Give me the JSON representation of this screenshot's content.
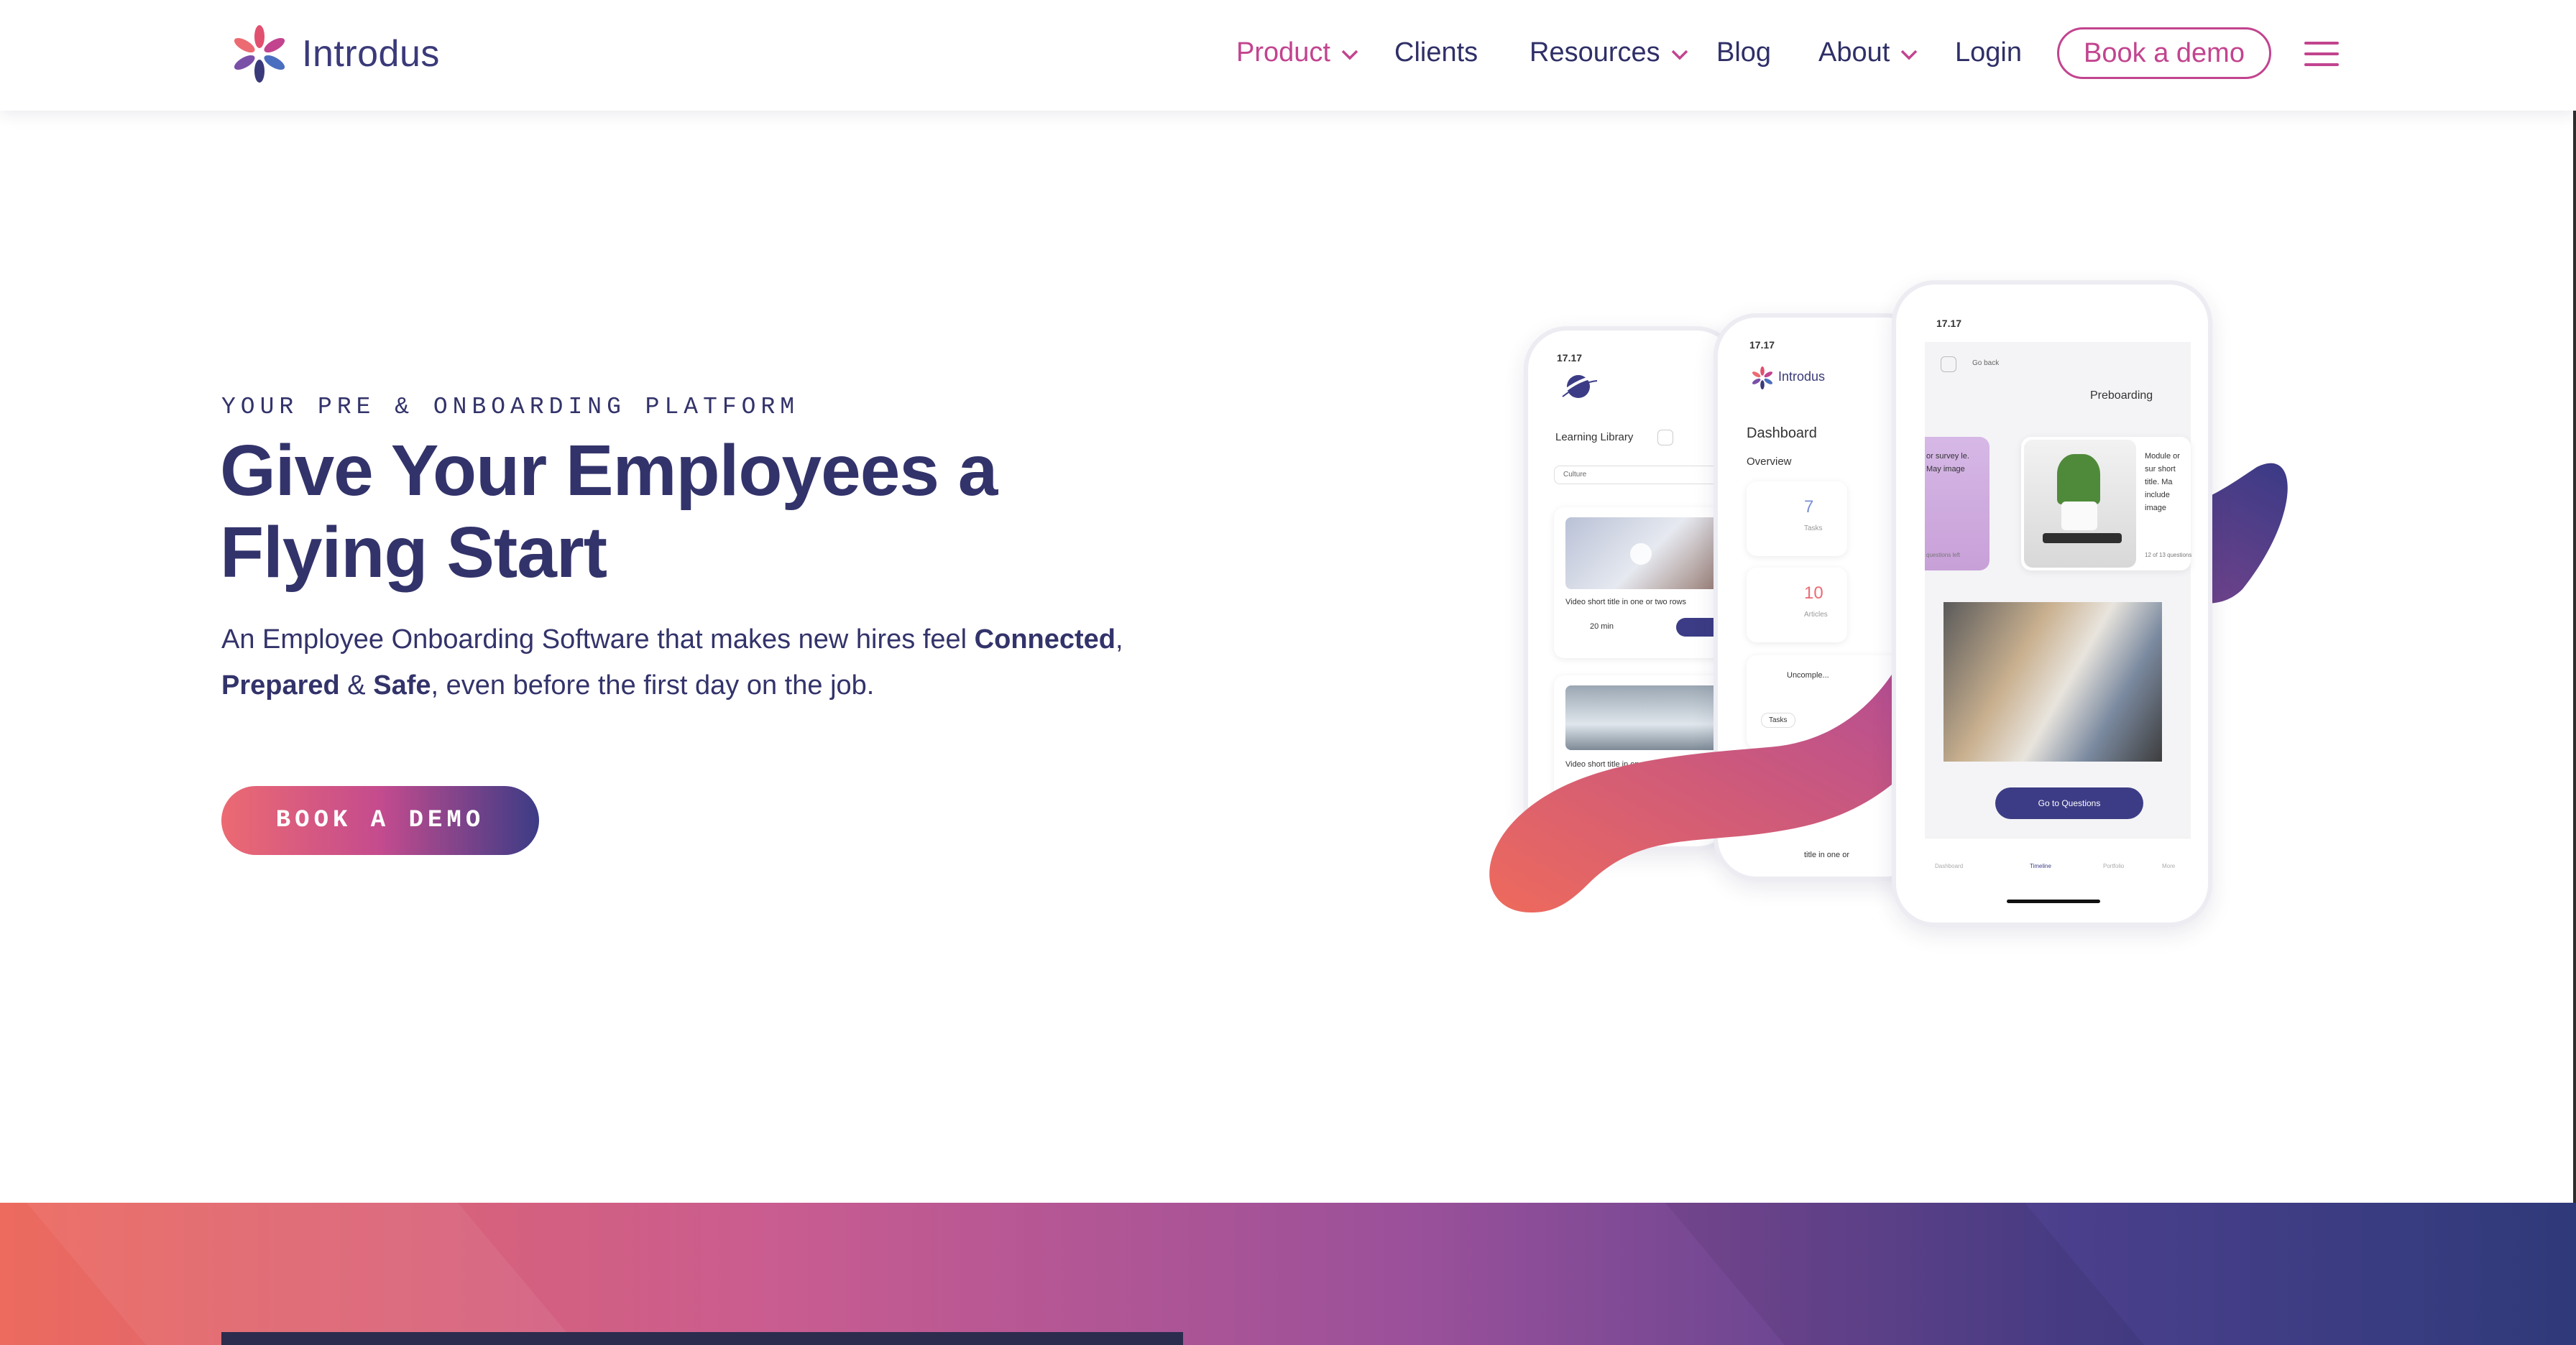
{
  "brand": {
    "name": "Introdus"
  },
  "nav": {
    "items": [
      {
        "label": "Product",
        "dropdown": true,
        "active": true
      },
      {
        "label": "Clients",
        "dropdown": false
      },
      {
        "label": "Resources",
        "dropdown": true
      },
      {
        "label": "Blog",
        "dropdown": false
      },
      {
        "label": "About",
        "dropdown": true
      },
      {
        "label": "Login",
        "dropdown": false
      }
    ],
    "cta_label": "Book a demo"
  },
  "hero": {
    "eyebrow": "YOUR PRE & ONBOARDING PLATFORM",
    "title_line1": "Give Your Employees a",
    "title_line2": "Flying Start",
    "sub_part1": "An Employee Onboarding Software that makes new hires feel ",
    "sub_b1": "Connected",
    "sub_part2": ",",
    "sub_b2": "Prepared",
    "sub_part3": " & ",
    "sub_b3": "Safe",
    "sub_part4": ", even before the first day on the job.",
    "cta_label": "BOOK A DEMO"
  },
  "phones": {
    "left": {
      "time": "17.17",
      "section": "Learning Library",
      "filter": "Culture",
      "video1_caption": "Video short title in one or two rows",
      "video1_duration": "20 min",
      "video2_caption": "Video short title in one or two rows"
    },
    "middle": {
      "time": "17.17",
      "brand": "Introdus",
      "heading": "Dashboard",
      "overview": "Overview",
      "tasks_count": "7",
      "tasks_label": "Tasks",
      "articles_count": "10",
      "articles_label": "Articles",
      "uncompleted": "Uncomple...",
      "tasks_chip": "Tasks",
      "footer_text": "title in one or"
    },
    "right": {
      "time": "17.17",
      "back": "Go back",
      "heading": "Preboarding",
      "card1_text": "or survey le. May image",
      "card1_meta": "questions left",
      "card2_text": "Module or sur short title. Ma include image",
      "card2_meta": "12 of 13 questions",
      "button": "Go to Questions",
      "tabs": [
        "Dashboard",
        "Timeline",
        "Portfolio",
        "More"
      ]
    }
  },
  "colors": {
    "primary": "#33336b",
    "accent": "#c2448f",
    "gradient_start": "#ec6a72",
    "gradient_end": "#3c3c86"
  }
}
